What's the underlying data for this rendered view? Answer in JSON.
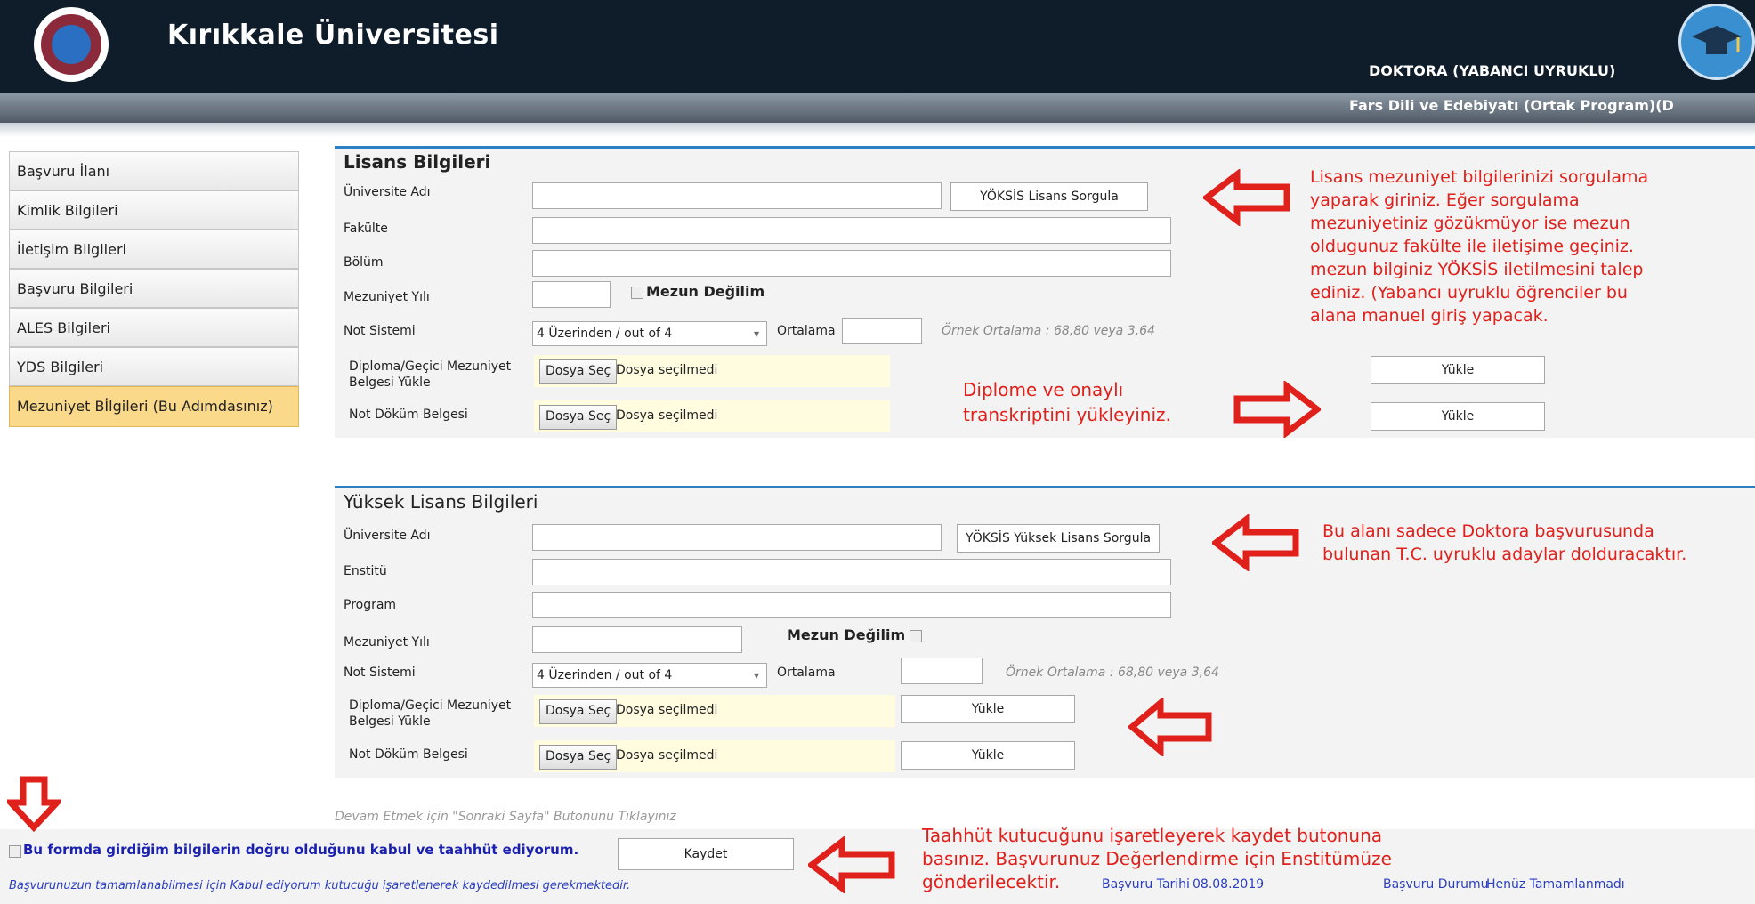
{
  "header": {
    "app_title": "Kırıkkale Üniversitesi",
    "program_level": "DOKTORA (YABANCI UYRUKLU)",
    "program_name": "Fars Dili ve Edebiyatı (Ortak Program)(D"
  },
  "sidebar": {
    "items": [
      {
        "label": "Başvuru İlanı"
      },
      {
        "label": "Kimlik Bilgileri"
      },
      {
        "label": "İletişim Bilgileri"
      },
      {
        "label": "Başvuru Bilgileri"
      },
      {
        "label": "ALES Bilgileri"
      },
      {
        "label": "YDS Bilgileri"
      },
      {
        "label": "Mezuniyet Bİlgileri (Bu Adımdasınız)"
      }
    ]
  },
  "lisans": {
    "title": "Lisans Bilgileri",
    "university_label": "Üniversite Adı",
    "university_value": "",
    "query_button": "YÖKSİS Lisans Sorgula",
    "faculty_label": "Fakülte",
    "department_label": "Bölüm",
    "grad_year_label": "Mezuniyet Yılı",
    "not_graduated_label": "Mezun Değilim",
    "grade_system_label": "Not Sistemi",
    "grade_system_value": "4 Üzerinden / out of 4",
    "average_label": "Ortalama",
    "average_hint": "Örnek Ortalama : 68,80 veya 3,64",
    "diploma_label_1": "Diploma/Geçici Mezuniyet",
    "diploma_label_2": "Belgesi Yükle",
    "transcript_label": "Not Döküm Belgesi",
    "choose_file": "Dosya Seç",
    "no_file": "Dosya seçilmedi",
    "upload_button": "Yükle"
  },
  "yuksek_lisans": {
    "title": "Yüksek Lisans Bilgileri",
    "university_label": "Üniversite Adı",
    "query_button": "YÖKSİS Yüksek Lisans Sorgula",
    "institute_label": "Enstitü",
    "program_label": "Program",
    "grad_year_label": "Mezuniyet Yılı",
    "not_graduated_label": "Mezun Değilim",
    "grade_system_label": "Not Sistemi",
    "grade_system_value": "4 Üzerinden / out of 4",
    "average_label": "Ortalama",
    "average_hint": "Örnek Ortalama : 68,80 veya 3,64",
    "diploma_label_1": "Diploma/Geçici Mezuniyet",
    "diploma_label_2": "Belgesi Yükle",
    "transcript_label": "Not Döküm Belgesi",
    "choose_file": "Dosya Seç",
    "no_file": "Dosya seçilmedi",
    "upload_button": "Yükle"
  },
  "footer": {
    "continue_hint": "Devam Etmek için \"Sonraki Sayfa\" Butonunu Tıklayınız",
    "commitment_label": "Bu formda girdiğim bilgilerin doğru olduğunu kabul ve taahhüt ediyorum.",
    "save_button": "Kaydet",
    "commitment_note": "Başvurunuzun tamamlanabilmesi için Kabul ediyorum kutucuğu işaretlenerek kaydedilmesi gerekmektedir.",
    "apply_date_label": "Başvuru Tarihi",
    "apply_date_value": "08.08.2019",
    "apply_status_label": "Başvuru Durumu",
    "apply_status_value": "Henüz Tamamlanmadı"
  },
  "annotations": {
    "note_lisans": [
      "Lisans mezuniyet bilgilerinizi sorgulama",
      "yaparak giriniz. Eğer sorgulama",
      "mezuniyetiniz gözükmüyor ise mezun",
      "oldugunuz fakülte ile iletişime geçiniz.",
      "mezun bilginiz YÖKSİS iletilmesini talep",
      "ediniz. (Yabancı uyruklu öğrenciler bu",
      "alana manuel giriş yapacak."
    ],
    "note_upload": [
      "Diplome ve onaylı",
      "transkriptini yükleyiniz."
    ],
    "note_yl": [
      "Bu alanı sadece Doktora başvurusunda",
      "bulunan T.C. uyruklu adaylar dolduracaktır."
    ],
    "note_commit": [
      "Taahhüt kutucuğunu işaretleyerek kaydet butonuna",
      "basınız. Başvurunuz Değerlendirme için Enstitümüze",
      "gönderilecektir."
    ],
    "arrow_color": "#e0201b"
  }
}
